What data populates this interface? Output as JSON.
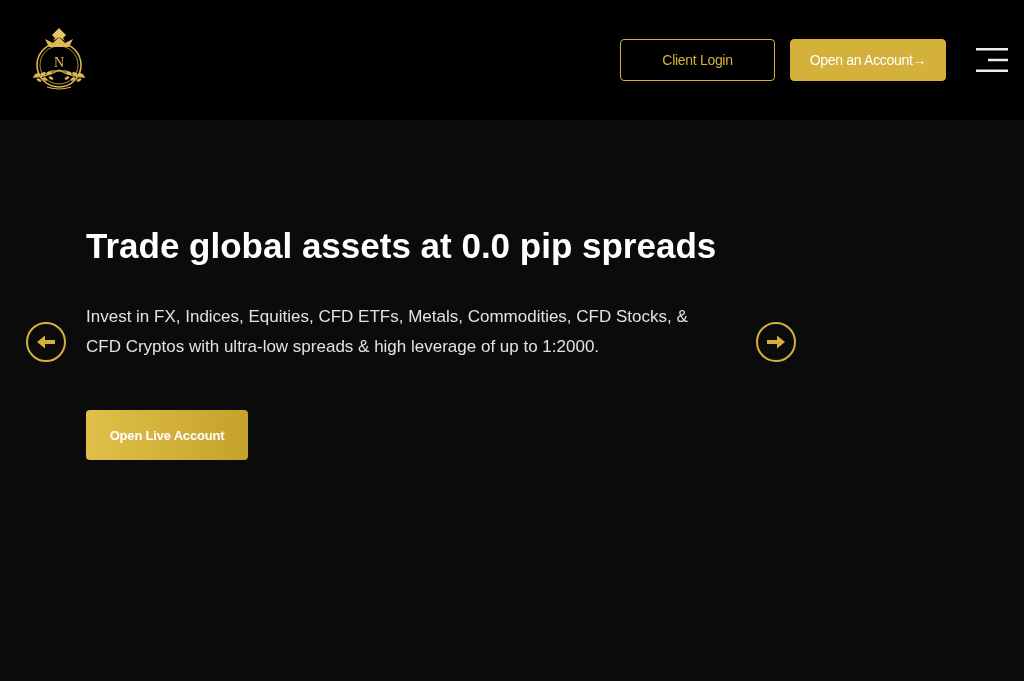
{
  "header": {
    "logo": {
      "letter": "N"
    },
    "buttons": [
      {
        "label": "Client Login",
        "kind": "outline"
      },
      {
        "label": "Open an Account→",
        "kind": "filled"
      }
    ]
  },
  "hero": {
    "title": "Trade global assets at 0.0 pip spreads",
    "text": "Invest in FX, Indices, Equities, CFD ETFs, Metals, Commodities, CFD Stocks, & CFD Cryptos with ultra-low spreads & high leverage of up to 1:2000.",
    "button": {
      "label": "Open Live Account"
    }
  }
}
